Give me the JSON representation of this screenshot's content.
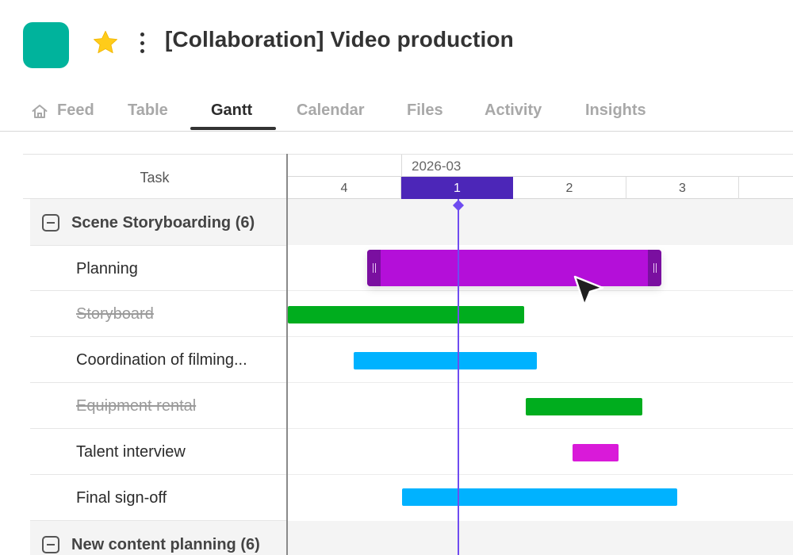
{
  "header": {
    "title": "[Collaboration] Video production",
    "app_icon_color": "#00b39c",
    "star_color": "#ffcc1a"
  },
  "tabs": [
    {
      "label": "Feed",
      "icon": "home-icon"
    },
    {
      "label": "Table"
    },
    {
      "label": "Gantt",
      "active": true
    },
    {
      "label": "Calendar"
    },
    {
      "label": "Files"
    },
    {
      "label": "Activity"
    },
    {
      "label": "Insights"
    }
  ],
  "gantt": {
    "task_header": "Task",
    "month": "2026-03",
    "days": [
      "4",
      "1",
      "2",
      "3"
    ],
    "today_index": 1,
    "groups": [
      {
        "label": "Scene Storyboarding (6)",
        "tasks": [
          {
            "name": "Planning",
            "done": false,
            "color": "#b40fd9",
            "selected": true
          },
          {
            "name": "Storyboard",
            "done": true,
            "color": "#00ad1e"
          },
          {
            "name": "Coordination of filming...",
            "done": false,
            "color": "#00b2ff"
          },
          {
            "name": "Equipment rental",
            "done": true,
            "color": "#00ad1e"
          },
          {
            "name": "Talent interview",
            "done": false,
            "color": "#d91ad9"
          },
          {
            "name": "Final sign-off",
            "done": false,
            "color": "#00b2ff"
          }
        ]
      },
      {
        "label": "New content planning (6)",
        "tasks": []
      }
    ],
    "today_color": "#6f4cf0",
    "selected_handle_color": "#7a0fa0"
  }
}
